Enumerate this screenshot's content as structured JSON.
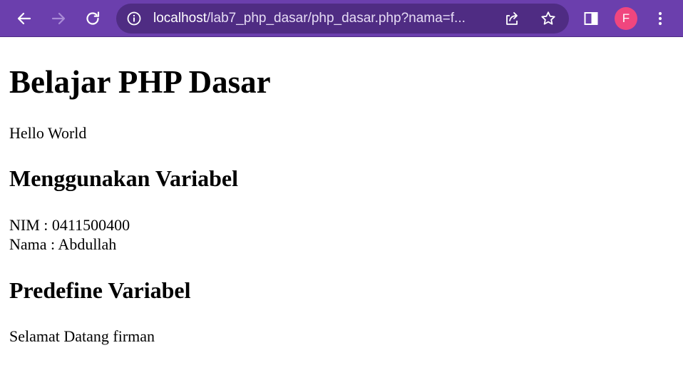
{
  "browser": {
    "url_host": "localhost",
    "url_path": "/lab7_php_dasar/php_dasar.php?nama=f...",
    "avatar_letter": "F",
    "icons": {
      "back": "back-arrow-icon",
      "forward": "forward-arrow-icon",
      "reload": "reload-icon",
      "info": "info-icon",
      "share": "share-icon",
      "bookmark": "star-icon",
      "side_panel": "side-panel-icon",
      "menu": "kebab-menu-icon"
    },
    "colors": {
      "toolbar": "#6b3fad",
      "omnibox": "#4f2c83",
      "avatar": "#f0467e"
    }
  },
  "page": {
    "title": "Belajar PHP Dasar",
    "hello": "Hello World",
    "section_variabel": "Menggunakan Variabel",
    "nim": "NIM : 0411500400",
    "nama": "Nama : Abdullah",
    "section_predefine": "Predefine Variabel",
    "welcome": "Selamat Datang firman"
  }
}
